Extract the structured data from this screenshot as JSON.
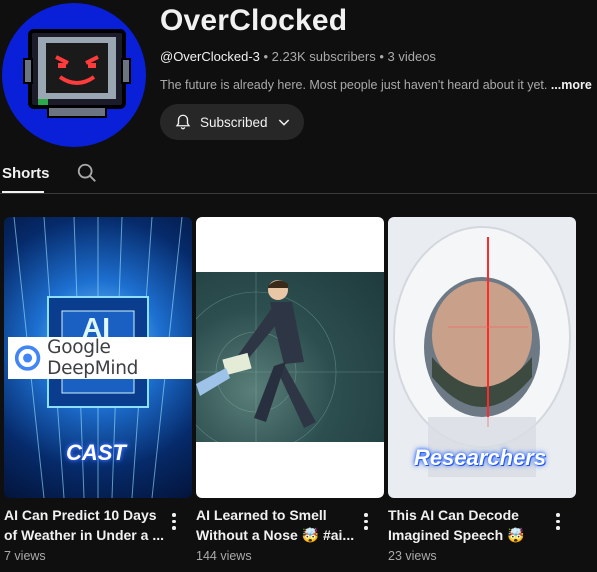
{
  "channel": {
    "name": "OverClocked",
    "handle": "@OverClocked-3",
    "stats": " • 2.23K subscribers • 3 videos",
    "description": "The future is already here. Most people just haven't heard about it yet.",
    "more_label": "...more",
    "subscribe_label": "Subscribed",
    "avatar_color": "#0a1fd8"
  },
  "tabs": {
    "shorts_label": "Shorts",
    "search_icon": "search-icon"
  },
  "videos": [
    {
      "title": "AI Can Predict 10 Days of Weather in Under a ...",
      "views": "7 views",
      "logo_text": "Google DeepMind",
      "caption": "CAST"
    },
    {
      "title": "AI Learned to Smell Without a Nose 🤯 #ai...",
      "views": "144 views"
    },
    {
      "title": "This AI Can Decode Imagined Speech 🤯",
      "views": "23 views",
      "caption": "Researchers"
    }
  ]
}
